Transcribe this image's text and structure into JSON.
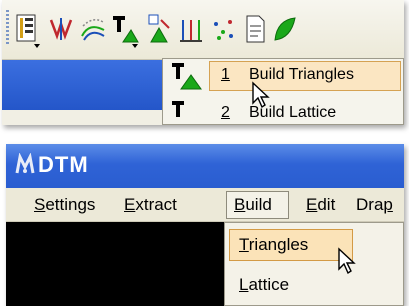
{
  "toolbar": {
    "icons": [
      "report-icon",
      "graph-icon",
      "contour-icon",
      "build-triangles-icon",
      "edit-triangles-icon",
      "columns-icon",
      "scatter-icon",
      "document-icon",
      "leaf-icon"
    ]
  },
  "flyout": {
    "item1": {
      "number": "1",
      "label": "Build Triangles"
    },
    "item2": {
      "number": "2",
      "label": "Build Lattice"
    }
  },
  "window": {
    "title": "DTM",
    "menu": [
      {
        "label": "Settings",
        "mnemonic": "S",
        "rest": "ettings"
      },
      {
        "label": "Extract",
        "mnemonic": "E",
        "rest": "xtract"
      },
      {
        "label": "Build",
        "mnemonic": "B",
        "rest": "uild"
      },
      {
        "label": "Edit",
        "mnemonic": "E",
        "rest": "dit"
      },
      {
        "label": "Drap",
        "mnemonic": "",
        "rest": "Dra",
        "tail": "p"
      }
    ],
    "build_menu": {
      "items": [
        {
          "label": "Triangles",
          "mnemonic": "T",
          "rest": "riangles"
        },
        {
          "label": "Lattice",
          "mnemonic": "L",
          "rest": "attice"
        }
      ]
    }
  },
  "colors": {
    "titlebar": "#2f63d6",
    "highlight": "#fbe3b8",
    "highlight_border": "#d39a45",
    "triangle_green": "#1aa81a"
  }
}
